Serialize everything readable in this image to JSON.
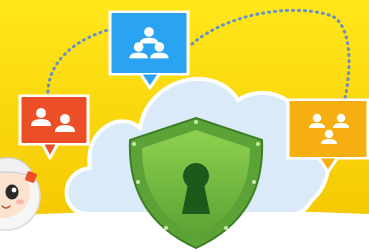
{
  "colors": {
    "background_top": "#ffe71a",
    "background_bottom": "#f3c400",
    "floor": "#ffffff",
    "cloud": "#dbeaf9",
    "cloud_outline": "#ffffff",
    "bubble_blue": "#2aa3f2",
    "bubble_red": "#ec4e25",
    "bubble_orange": "#f6ae11",
    "connector_dots": "#6690c8",
    "shield_outer": "#5ba337",
    "shield_inner": "#7cc242",
    "keyhole": "#1b5a1b"
  },
  "icons": {
    "group_icon": "user-group-icon",
    "lock_icon": "keyhole-shield-icon"
  }
}
